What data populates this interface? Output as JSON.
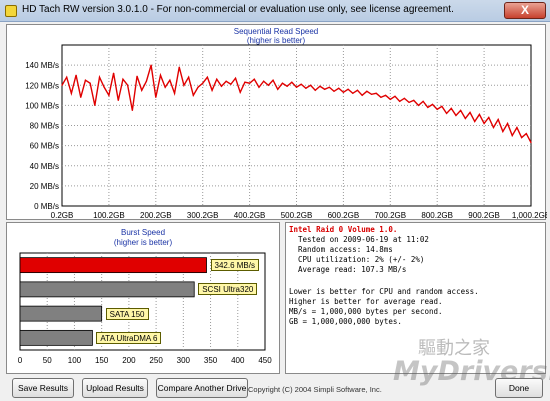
{
  "window": {
    "title": "HD Tach RW version 3.0.1.0  - For non-commercial or evaluation use only, see license agreement.",
    "close_label": "X"
  },
  "read_panel": {
    "title": "Sequential Read Speed",
    "subtitle": "(higher is better)"
  },
  "burst_panel": {
    "title": "Burst Speed",
    "subtitle": "(higher is better)"
  },
  "chart_data": [
    {
      "type": "line",
      "title": "Sequential Read Speed",
      "subtitle": "(higher is better)",
      "ylim": [
        0,
        160
      ],
      "xlim": [
        0.2,
        1000
      ],
      "y_ticks": [
        "0 MB/s",
        "20 MB/s",
        "40 MB/s",
        "60 MB/s",
        "80 MB/s",
        "100 MB/s",
        "120 MB/s",
        "140 MB/s"
      ],
      "x_ticks": [
        "0.2GB",
        "100.2GB",
        "200.2GB",
        "300.2GB",
        "400.2GB",
        "500.2GB",
        "600.2GB",
        "700.2GB",
        "800.2GB",
        "900.2GB",
        "1,000.2GB"
      ],
      "grid": true,
      "color": "#e00000",
      "series": [
        {
          "x": [
            0,
            10,
            20,
            30,
            40,
            50,
            60,
            70,
            80,
            90,
            100,
            110,
            120,
            130,
            140,
            150,
            160,
            170,
            180,
            190,
            200,
            210,
            220,
            230,
            240,
            250,
            260,
            270,
            280,
            290,
            300,
            310,
            320,
            330,
            340,
            350,
            360,
            370,
            380,
            390,
            400,
            410,
            420,
            430,
            440,
            450,
            460,
            470,
            480,
            490,
            500,
            510,
            520,
            530,
            540,
            550,
            560,
            570,
            580,
            590,
            600,
            610,
            620,
            630,
            640,
            650,
            660,
            670,
            680,
            690,
            700,
            710,
            720,
            730,
            740,
            750,
            760,
            770,
            780,
            790,
            800,
            810,
            820,
            830,
            840,
            850,
            860,
            870,
            880,
            890,
            900,
            910,
            920,
            930,
            940,
            950,
            960,
            970,
            980,
            990,
            1000
          ],
          "values": [
            120,
            128,
            112,
            130,
            108,
            125,
            122,
            100,
            128,
            118,
            110,
            132,
            105,
            126,
            120,
            95,
            129,
            115,
            124,
            140,
            108,
            130,
            118,
            125,
            112,
            138,
            120,
            128,
            110,
            118,
            122,
            128,
            115,
            126,
            119,
            124,
            121,
            127,
            113,
            123,
            122,
            126,
            118,
            124,
            120,
            125,
            116,
            122,
            119,
            123,
            118,
            121,
            117,
            120,
            115,
            119,
            116,
            118,
            114,
            117,
            113,
            116,
            112,
            115,
            110,
            114,
            111,
            112,
            108,
            110,
            106,
            109,
            104,
            107,
            103,
            105,
            100,
            104,
            98,
            101,
            96,
            99,
            92,
            97,
            90,
            95,
            87,
            93,
            84,
            91,
            82,
            88,
            78,
            86,
            74,
            82,
            70,
            78,
            68,
            72,
            63
          ]
        }
      ]
    },
    {
      "type": "bar",
      "title": "Burst Speed",
      "subtitle": "(higher is better)",
      "orientation": "horizontal",
      "xlim": [
        0,
        450
      ],
      "x_ticks": [
        "0",
        "50",
        "100",
        "150",
        "200",
        "250",
        "300",
        "350",
        "400",
        "450"
      ],
      "categories": [
        "342.6 MB/s",
        "SCSI Ultra320",
        "SATA 150",
        "ATA UltraDMA 6"
      ],
      "values": [
        342.6,
        320,
        150,
        133
      ],
      "colors": [
        "#e00000",
        "#808080",
        "#808080",
        "#808080"
      ]
    }
  ],
  "info": {
    "header": "Intel Raid 0 Volume 1.0.",
    "tested": "Tested on 2009-06-19 at 11:02",
    "access": "Random access: 14.8ms",
    "cpu": "CPU utilization: 2% (+/- 2%)",
    "avg": "Average read: 107.3 MB/s",
    "note1": "Lower is better for CPU and random access.",
    "note2": "Higher is better for average read.",
    "note3": "MB/s = 1,000,000 bytes per second.",
    "note4": "GB = 1,000,000,000 bytes."
  },
  "buttons": {
    "save": "Save Results",
    "upload": "Upload Results",
    "compare": "Compare Another Drive",
    "done": "Done"
  },
  "footer": {
    "copyright": "Copyright (C) 2004 Simpli Software, Inc."
  },
  "watermark": {
    "cn": "驅動之家",
    "en": "MyDrivers.com"
  }
}
